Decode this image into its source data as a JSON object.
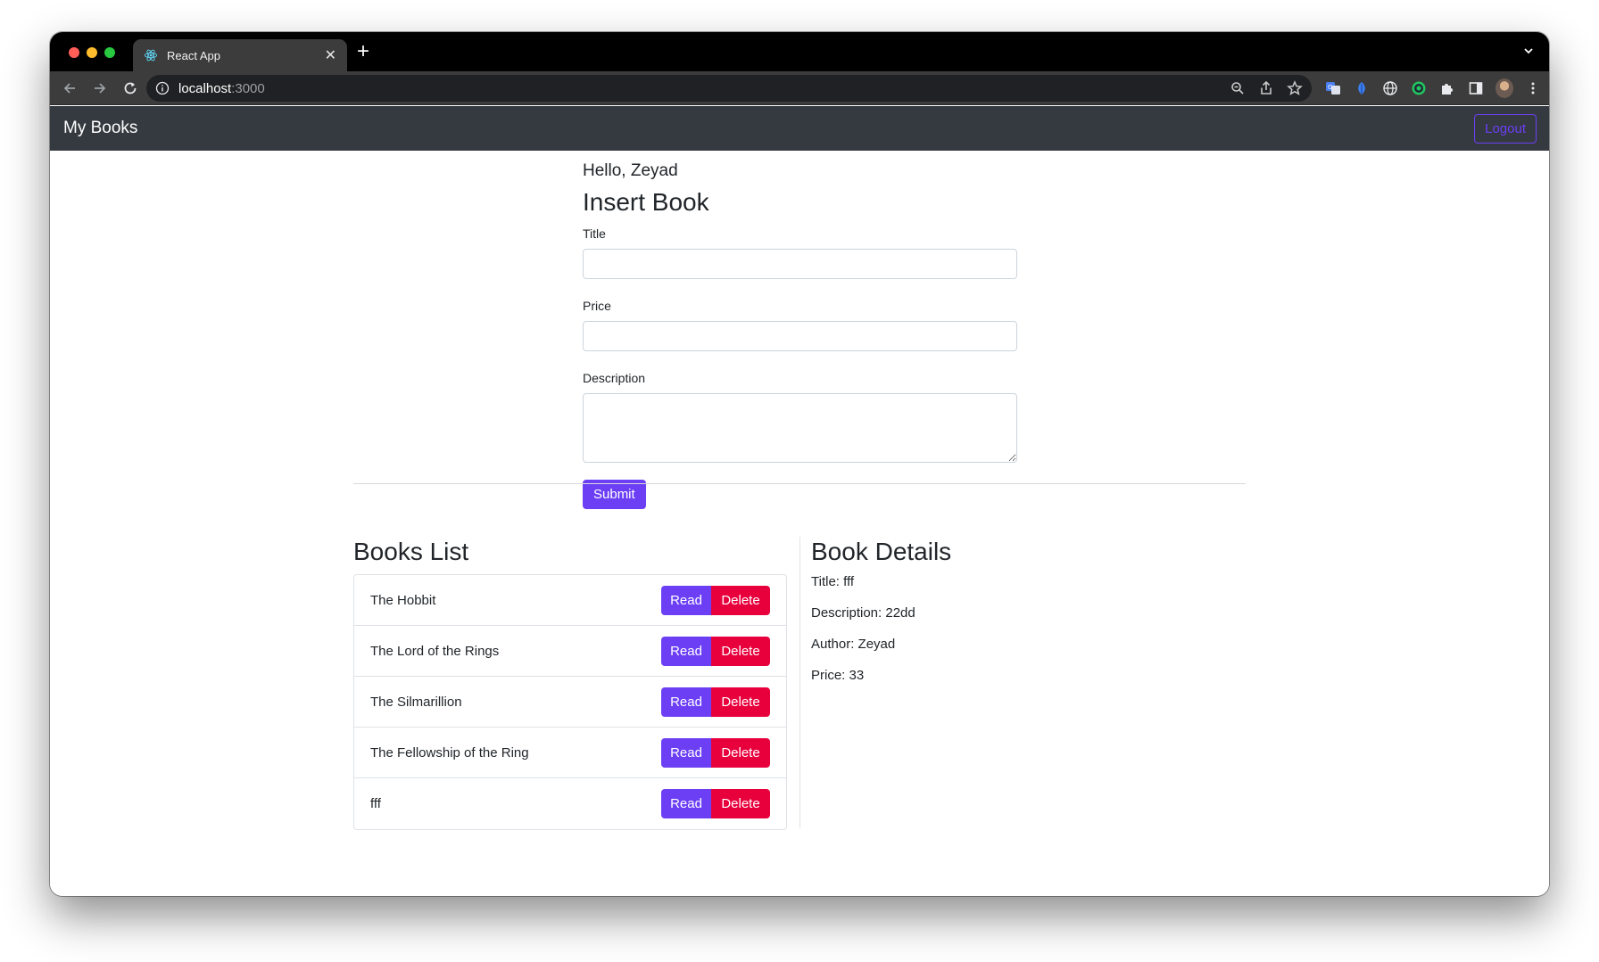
{
  "browser": {
    "tab_title": "React App",
    "new_tab_label": "+",
    "url_host": "localhost",
    "url_port": ":3000"
  },
  "navbar": {
    "brand": "My Books",
    "logout_label": "Logout"
  },
  "form": {
    "greeting": "Hello, Zeyad",
    "heading": "Insert Book",
    "title_label": "Title",
    "title_value": "",
    "price_label": "Price",
    "price_value": "",
    "description_label": "Description",
    "description_value": "",
    "submit_label": "Submit"
  },
  "books_list": {
    "heading": "Books List",
    "read_label": "Read",
    "delete_label": "Delete",
    "items": [
      {
        "title": "The Hobbit"
      },
      {
        "title": "The Lord of the Rings"
      },
      {
        "title": "The Silmarillion"
      },
      {
        "title": "The Fellowship of the Ring"
      },
      {
        "title": "fff"
      }
    ]
  },
  "book_details": {
    "heading": "Book Details",
    "title": "Title: fff",
    "description": "Description: 22dd",
    "author": "Author: Zeyad",
    "price": "Price: 33"
  },
  "colors": {
    "primary": "#6c3ff5",
    "danger": "#e8003c",
    "navbar": "#343a40"
  },
  "icons": [
    "react-logo-icon",
    "close-icon",
    "back-arrow-icon",
    "forward-arrow-icon",
    "reload-icon",
    "info-icon",
    "zoom-icon",
    "share-icon",
    "bookmark-star-icon",
    "translate-icon",
    "extension-icon",
    "puzzle-icon",
    "sidebar-icon",
    "avatar",
    "kebab-menu-icon"
  ]
}
